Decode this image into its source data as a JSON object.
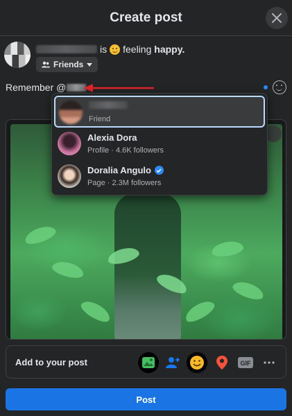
{
  "header": {
    "title": "Create post"
  },
  "composer": {
    "status_is": "is",
    "status_feeling": "feeling",
    "status_mood": "happy.",
    "audience_label": "Friends",
    "text_prefix": "Remember @"
  },
  "mention_suggestions": [
    {
      "name": "",
      "subtitle": "Friend",
      "selected": true
    },
    {
      "name": "Alexia Dora",
      "subtitle": "Profile · 4.6K followers",
      "selected": false
    },
    {
      "name": "Doralia Angulo",
      "subtitle": "Page · 2.3M followers",
      "verified": true,
      "selected": false
    }
  ],
  "add_to_post": {
    "label": "Add to your post",
    "icons": [
      "photo-video-icon",
      "tag-people-icon",
      "feeling-activity-icon",
      "check-in-icon",
      "gif-icon",
      "more-icon"
    ]
  },
  "post_button": {
    "label": "Post"
  },
  "colors": {
    "accent": "#1b74e4",
    "background": "#242526",
    "annotation_arrow": "#e0252b"
  }
}
